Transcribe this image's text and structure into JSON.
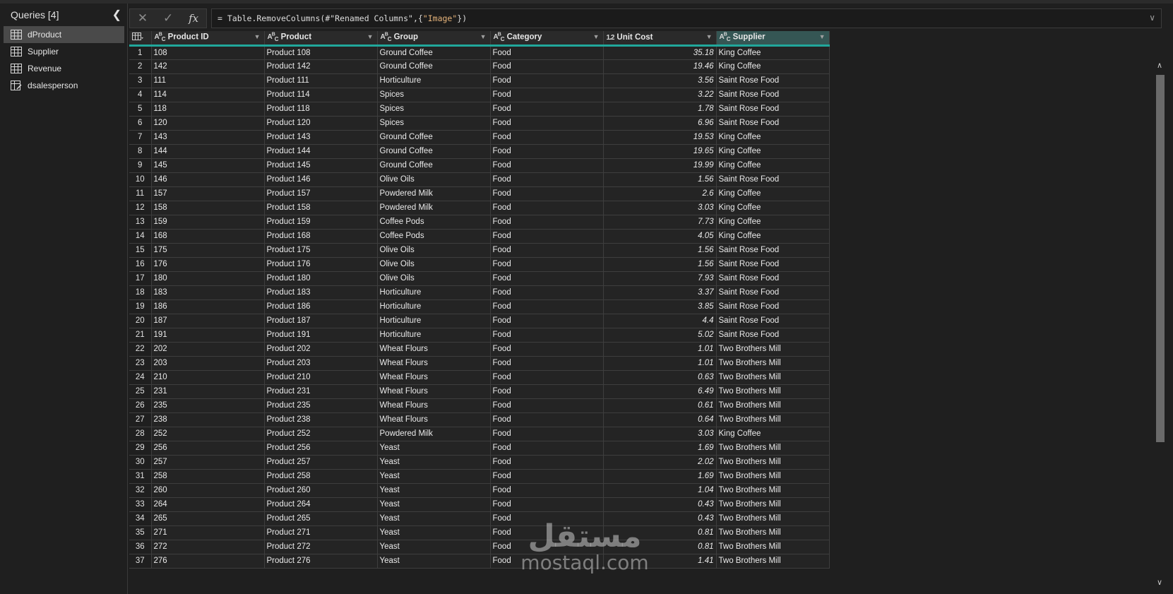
{
  "queries": {
    "title": "Queries [4]",
    "items": [
      {
        "label": "dProduct",
        "icon": "table-icon"
      },
      {
        "label": "Supplier",
        "icon": "table-icon"
      },
      {
        "label": "Revenue",
        "icon": "table-icon"
      },
      {
        "label": "dsalesperson",
        "icon": "table-edit-icon"
      }
    ]
  },
  "formula": {
    "prefix": "= Table.RemoveColumns(#\"Renamed Columns\",{",
    "string": "\"Image\"",
    "suffix": "})"
  },
  "grid": {
    "columns": [
      {
        "label": "Product ID",
        "type": "ABC"
      },
      {
        "label": "Product",
        "type": "ABC"
      },
      {
        "label": "Group",
        "type": "ABC"
      },
      {
        "label": "Category",
        "type": "ABC"
      },
      {
        "label": "Unit Cost",
        "type": "1.2"
      },
      {
        "label": "Supplier",
        "type": "ABC"
      }
    ],
    "rows": [
      [
        "1",
        "108",
        "Product 108",
        "Ground Coffee",
        "Food",
        "35.18",
        "King Coffee"
      ],
      [
        "2",
        "142",
        "Product 142",
        "Ground Coffee",
        "Food",
        "19.46",
        "King Coffee"
      ],
      [
        "3",
        "111",
        "Product 111",
        "Horticulture",
        "Food",
        "3.56",
        "Saint Rose Food"
      ],
      [
        "4",
        "114",
        "Product 114",
        "Spices",
        "Food",
        "3.22",
        "Saint Rose Food"
      ],
      [
        "5",
        "118",
        "Product 118",
        "Spices",
        "Food",
        "1.78",
        "Saint Rose Food"
      ],
      [
        "6",
        "120",
        "Product 120",
        "Spices",
        "Food",
        "6.96",
        "Saint Rose Food"
      ],
      [
        "7",
        "143",
        "Product 143",
        "Ground Coffee",
        "Food",
        "19.53",
        "King Coffee"
      ],
      [
        "8",
        "144",
        "Product 144",
        "Ground Coffee",
        "Food",
        "19.65",
        "King Coffee"
      ],
      [
        "9",
        "145",
        "Product 145",
        "Ground Coffee",
        "Food",
        "19.99",
        "King Coffee"
      ],
      [
        "10",
        "146",
        "Product 146",
        "Olive Oils",
        "Food",
        "1.56",
        "Saint Rose Food"
      ],
      [
        "11",
        "157",
        "Product 157",
        "Powdered Milk",
        "Food",
        "2.6",
        "King Coffee"
      ],
      [
        "12",
        "158",
        "Product 158",
        "Powdered Milk",
        "Food",
        "3.03",
        "King Coffee"
      ],
      [
        "13",
        "159",
        "Product 159",
        "Coffee Pods",
        "Food",
        "7.73",
        "King Coffee"
      ],
      [
        "14",
        "168",
        "Product 168",
        "Coffee Pods",
        "Food",
        "4.05",
        "King Coffee"
      ],
      [
        "15",
        "175",
        "Product 175",
        "Olive Oils",
        "Food",
        "1.56",
        "Saint Rose Food"
      ],
      [
        "16",
        "176",
        "Product 176",
        "Olive Oils",
        "Food",
        "1.56",
        "Saint Rose Food"
      ],
      [
        "17",
        "180",
        "Product 180",
        "Olive Oils",
        "Food",
        "7.93",
        "Saint Rose Food"
      ],
      [
        "18",
        "183",
        "Product 183",
        "Horticulture",
        "Food",
        "3.37",
        "Saint Rose Food"
      ],
      [
        "19",
        "186",
        "Product 186",
        "Horticulture",
        "Food",
        "3.85",
        "Saint Rose Food"
      ],
      [
        "20",
        "187",
        "Product 187",
        "Horticulture",
        "Food",
        "4.4",
        "Saint Rose Food"
      ],
      [
        "21",
        "191",
        "Product 191",
        "Horticulture",
        "Food",
        "5.02",
        "Saint Rose Food"
      ],
      [
        "22",
        "202",
        "Product 202",
        "Wheat Flours",
        "Food",
        "1.01",
        "Two Brothers Mill"
      ],
      [
        "23",
        "203",
        "Product 203",
        "Wheat Flours",
        "Food",
        "1.01",
        "Two Brothers Mill"
      ],
      [
        "24",
        "210",
        "Product 210",
        "Wheat Flours",
        "Food",
        "0.63",
        "Two Brothers Mill"
      ],
      [
        "25",
        "231",
        "Product 231",
        "Wheat Flours",
        "Food",
        "6.49",
        "Two Brothers Mill"
      ],
      [
        "26",
        "235",
        "Product 235",
        "Wheat Flours",
        "Food",
        "0.61",
        "Two Brothers Mill"
      ],
      [
        "27",
        "238",
        "Product 238",
        "Wheat Flours",
        "Food",
        "0.64",
        "Two Brothers Mill"
      ],
      [
        "28",
        "252",
        "Product 252",
        "Powdered Milk",
        "Food",
        "3.03",
        "King Coffee"
      ],
      [
        "29",
        "256",
        "Product 256",
        "Yeast",
        "Food",
        "1.69",
        "Two Brothers Mill"
      ],
      [
        "30",
        "257",
        "Product 257",
        "Yeast",
        "Food",
        "2.02",
        "Two Brothers Mill"
      ],
      [
        "31",
        "258",
        "Product 258",
        "Yeast",
        "Food",
        "1.69",
        "Two Brothers Mill"
      ],
      [
        "32",
        "260",
        "Product 260",
        "Yeast",
        "Food",
        "1.04",
        "Two Brothers Mill"
      ],
      [
        "33",
        "264",
        "Product 264",
        "Yeast",
        "Food",
        "0.43",
        "Two Brothers Mill"
      ],
      [
        "34",
        "265",
        "Product 265",
        "Yeast",
        "Food",
        "0.43",
        "Two Brothers Mill"
      ],
      [
        "35",
        "271",
        "Product 271",
        "Yeast",
        "Food",
        "0.81",
        "Two Brothers Mill"
      ],
      [
        "36",
        "272",
        "Product 272",
        "Yeast",
        "Food",
        "0.81",
        "Two Brothers Mill"
      ],
      [
        "37",
        "276",
        "Product 276",
        "Yeast",
        "Food",
        "1.41",
        "Two Brothers Mill"
      ]
    ]
  },
  "watermark": {
    "arabic": "مستقل",
    "latin": "mostaql.com"
  },
  "colors": {
    "accent": "#21a79b",
    "background": "#1f1f1f",
    "selected_header": "#355654"
  }
}
